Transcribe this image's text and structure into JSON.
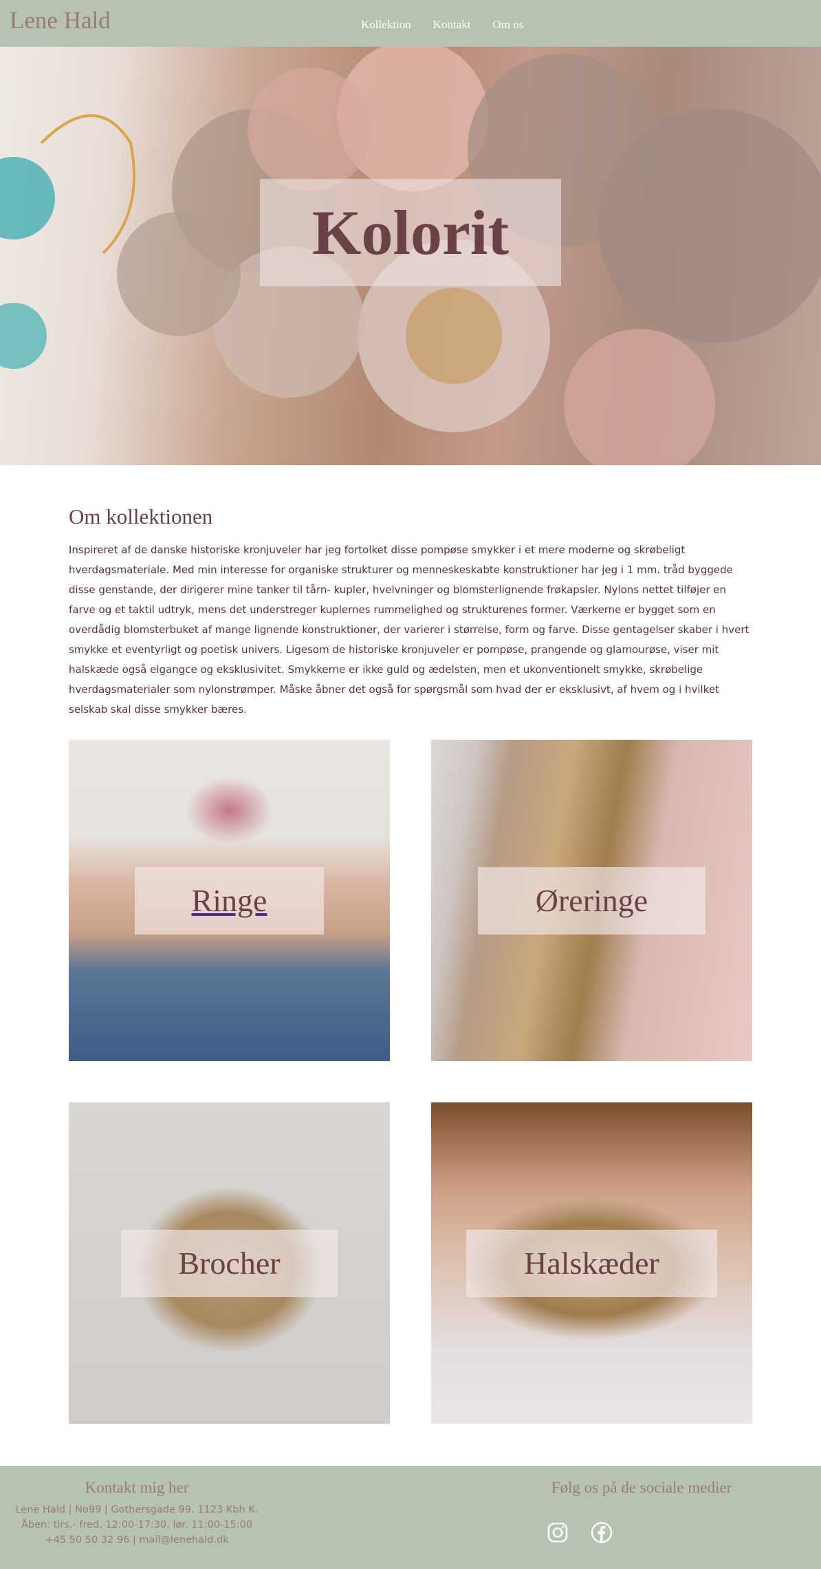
{
  "header": {
    "logo": "Lene Hald",
    "nav": [
      "Kollektion",
      "Kontakt",
      "Om os"
    ],
    "background_color": "#b6c3b1"
  },
  "hero": {
    "title": "Kolorit"
  },
  "about": {
    "heading": "Om kollektionen",
    "text": "Inspireret af de danske historiske kronjuveler har jeg fortolket disse pompøse smykker i et mere moderne og skrøbeligt hverdagsmateriale. Med min interesse for organiske strukturer og menneskeskabte konstruktioner har jeg i 1 mm. tråd byggede disse genstande, der dirigerer mine tanker til tårn- kupler, hvelvninger og blomsterlignende frøkapsler. Nylons nettet tilføjer en farve og et taktil udtryk, mens det understreger kuplernes rummelighed og strukturenes former. Værkerne er bygget som en overdådig blomsterbuket af mange lignende konstruktioner, der varierer i størrelse, form og farve. Disse gentagelser skaber i hvert smykke et eventyrligt og poetisk univers. Ligesom de historiske kronjuveler er pompøse, prangende og glamourøse, viser mit halskæde også elgangce og eksklusivitet. Smykkerne er ikke guld og ædelsten, men et ukonventionelt smykke, skrøbelige hverdagsmaterialer som nylonstrømper. Måske åbner det også for spørgsmål som hvad der er eksklusivt, af hvem og i hvilket selskab skal disse smykker bæres."
  },
  "categories": [
    {
      "label": "Ringe"
    },
    {
      "label": "Øreringe"
    },
    {
      "label": "Brocher"
    },
    {
      "label": "Halskæder"
    }
  ],
  "footer": {
    "contact_title": "Kontakt mig her",
    "contact_lines": [
      "Lene Hald | No99 | Gothersgade 99. 1123 Kbh K.",
      "Åben: tirs.- fred. 12:00-17:30, lør. 11:00-15:00",
      "+45 50 50 32 96 | mail@lenehald.dk"
    ],
    "social_title": "Følg os på de sociale medier",
    "social_icons": [
      "instagram-icon",
      "facebook-icon"
    ]
  }
}
